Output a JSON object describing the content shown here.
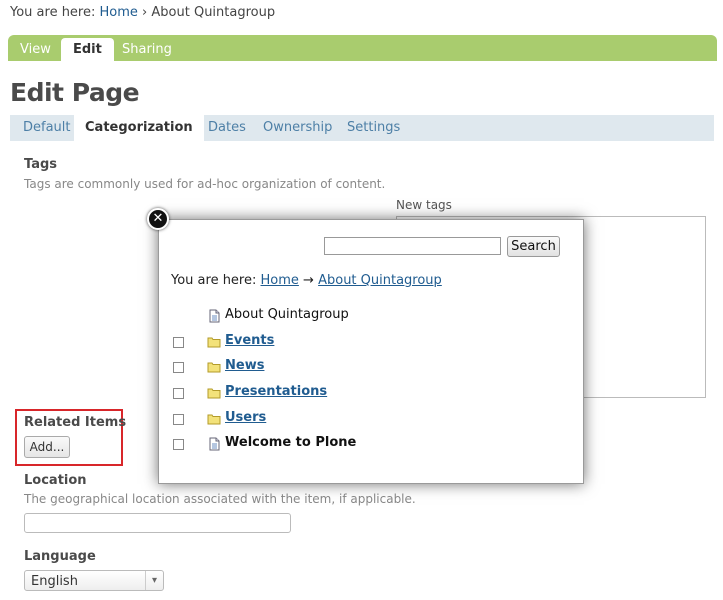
{
  "breadcrumb": {
    "prefix": "You are here:",
    "home": "Home",
    "separator": "›",
    "current": "About Quintagroup"
  },
  "edit_bar": {
    "tabs": [
      {
        "label": "View"
      },
      {
        "label": "Edit"
      },
      {
        "label": "Sharing"
      }
    ]
  },
  "page_title": "Edit Page",
  "fieldset_tabs": [
    {
      "label": "Default"
    },
    {
      "label": "Categorization"
    },
    {
      "label": "Dates"
    },
    {
      "label": "Ownership"
    },
    {
      "label": "Settings"
    }
  ],
  "fields": {
    "tags": {
      "label": "Tags",
      "help": "Tags are commonly used for ad-hoc organization of content.",
      "new_tags_label": "New tags"
    },
    "related": {
      "label": "Related Items",
      "add_button": "Add..."
    },
    "location": {
      "label": "Location",
      "help": "The geographical location associated with the item, if applicable.",
      "value": ""
    },
    "language": {
      "label": "Language",
      "selected": "English"
    }
  },
  "overlay": {
    "close_glyph": "✕",
    "search_value": "",
    "search_button": "Search",
    "breadcrumb": {
      "prefix": "You are here:",
      "home": "Home",
      "arrow": "→",
      "current": "About Quintagroup"
    },
    "items": [
      {
        "label": "About Quintagroup",
        "type": "page",
        "checkbox": false,
        "style": "plain"
      },
      {
        "label": "Events",
        "type": "folder",
        "checkbox": true,
        "style": "link"
      },
      {
        "label": "News",
        "type": "folder",
        "checkbox": true,
        "style": "link"
      },
      {
        "label": "Presentations",
        "type": "folder",
        "checkbox": true,
        "style": "link"
      },
      {
        "label": "Users",
        "type": "folder",
        "checkbox": true,
        "style": "link"
      },
      {
        "label": "Welcome to Plone",
        "type": "page",
        "checkbox": true,
        "style": "bold"
      }
    ]
  },
  "colors": {
    "edit_bar": "#a9cc6e",
    "fieldset_tabs": "#dfe8ee",
    "link": "#205c90",
    "highlight_border": "#d8262a"
  }
}
